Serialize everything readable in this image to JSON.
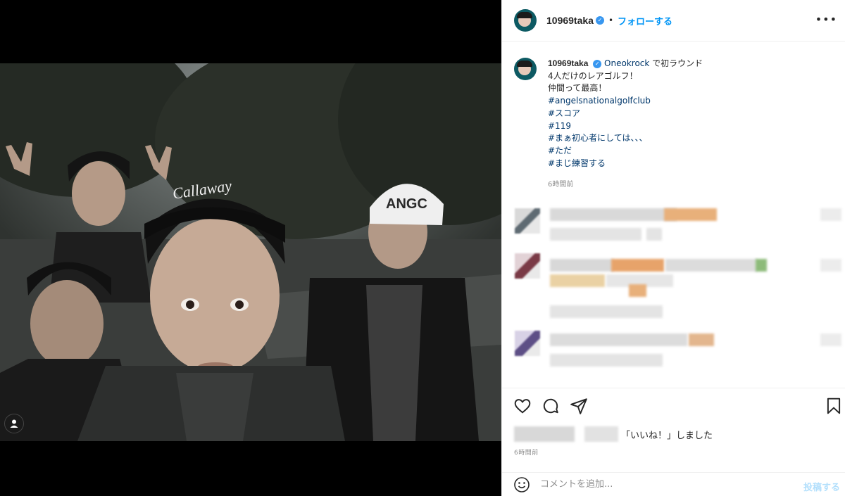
{
  "post": {
    "username": "10969taka",
    "follow_label": "フォローする",
    "separator": "•",
    "more_label": "•••"
  },
  "caption": {
    "mention": "Oneokrock",
    "lines": [
      "で初ラウンド",
      "4人だけのレアゴルフ！",
      "仲間って最高！",
      "#angelsnationalgolfclub",
      "#スコア",
      "#119",
      "#まぁ初心者にしては、、、",
      "#ただ",
      "#まじ練習する"
    ],
    "time_ago": "6時間前"
  },
  "photo": {
    "cap_logo": "Callaway",
    "cap_text_right": "ANGC"
  },
  "likes": {
    "suffix": "「いいね！」しました"
  },
  "post_time": "6時間前",
  "comment_box": {
    "placeholder": "コメントを追加...",
    "post_label": "投稿する"
  },
  "icons": [
    "heart-icon",
    "comment-icon",
    "share-icon",
    "bookmark-icon",
    "emoji-icon",
    "user-tag-icon",
    "verified-badge-icon",
    "more-icon"
  ],
  "colors": {
    "accent": "#0095f6",
    "hashtag": "#00376b",
    "verified": "#3897f0",
    "muted": "#8e8e8e"
  }
}
